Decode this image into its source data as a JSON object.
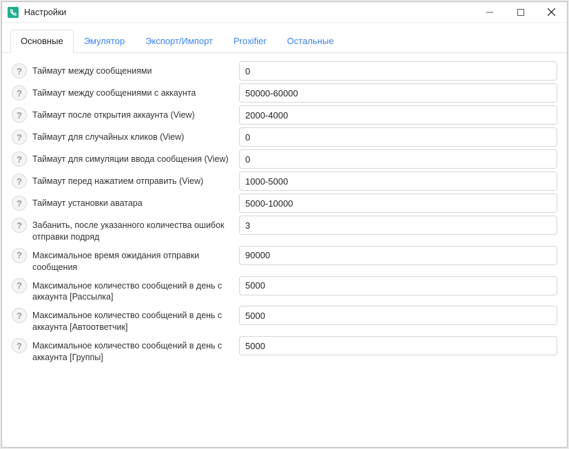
{
  "window_title": "Настройки",
  "tabs": {
    "main": "Основные",
    "emulator": "Эмулятор",
    "exportimport": "Экспорт/Импорт",
    "proxifier": "Proxifier",
    "other": "Остальные"
  },
  "rows": {
    "r0": {
      "label": "Таймаут между сообщениями",
      "value": "0"
    },
    "r1": {
      "label": "Таймаут между сообщениями с аккаунта",
      "value": "50000-60000"
    },
    "r2": {
      "label": "Таймаут после открытия аккаунта (View)",
      "value": "2000-4000"
    },
    "r3": {
      "label": "Таймаут для случайных кликов (View)",
      "value": "0"
    },
    "r4": {
      "label": "Таймаут для симуляции ввода сообщения (View)",
      "value": "0"
    },
    "r5": {
      "label": "Таймаут перед нажатием отправить (View)",
      "value": "1000-5000"
    },
    "r6": {
      "label": "Таймаут установки аватара",
      "value": "5000-10000"
    },
    "r7": {
      "label": "Забанить, после указанного количества ошибок отправки подряд",
      "value": "3"
    },
    "r8": {
      "label": "Максимальное время ожидания отправки сообщения",
      "value": "90000"
    },
    "r9": {
      "label": "Максимальное количество сообщений в день с аккаунта [Рассылка]",
      "value": "5000"
    },
    "r10": {
      "label": "Максимальное количество сообщений в день с аккаунта [Автоответчик]",
      "value": "5000"
    },
    "r11": {
      "label": "Максимальное количество сообщений в день с аккаунта [Группы]",
      "value": "5000"
    }
  }
}
